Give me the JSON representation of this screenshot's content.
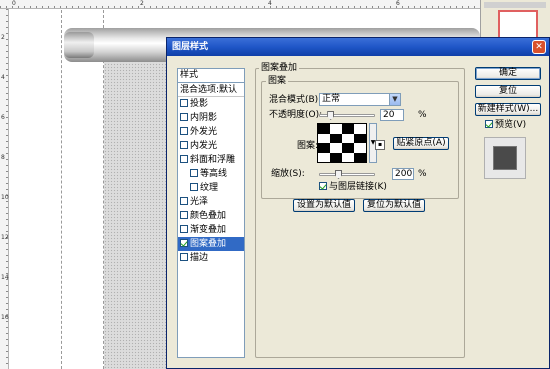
{
  "ruler": {
    "top_numbers": [
      "0",
      "2",
      "4",
      "6"
    ],
    "left_numbers": [
      "2",
      "4",
      "6",
      "8",
      "10",
      "12",
      "14",
      "16"
    ]
  },
  "dialog": {
    "title": "图层样式",
    "close_symbol": "✕",
    "styles_header": "样式",
    "style_items": [
      {
        "label": "混合选项:默认",
        "checkbox": false,
        "checked": false,
        "sub": false,
        "selected": false
      },
      {
        "label": "投影",
        "checkbox": true,
        "checked": false,
        "sub": false,
        "selected": false
      },
      {
        "label": "内阴影",
        "checkbox": true,
        "checked": false,
        "sub": false,
        "selected": false
      },
      {
        "label": "外发光",
        "checkbox": true,
        "checked": false,
        "sub": false,
        "selected": false
      },
      {
        "label": "内发光",
        "checkbox": true,
        "checked": false,
        "sub": false,
        "selected": false
      },
      {
        "label": "斜面和浮雕",
        "checkbox": true,
        "checked": false,
        "sub": false,
        "selected": false
      },
      {
        "label": "等高线",
        "checkbox": true,
        "checked": false,
        "sub": true,
        "selected": false
      },
      {
        "label": "纹理",
        "checkbox": true,
        "checked": false,
        "sub": true,
        "selected": false
      },
      {
        "label": "光泽",
        "checkbox": true,
        "checked": false,
        "sub": false,
        "selected": false
      },
      {
        "label": "颜色叠加",
        "checkbox": true,
        "checked": false,
        "sub": false,
        "selected": false
      },
      {
        "label": "渐变叠加",
        "checkbox": true,
        "checked": false,
        "sub": false,
        "selected": false
      },
      {
        "label": "图案叠加",
        "checkbox": true,
        "checked": true,
        "sub": false,
        "selected": true
      },
      {
        "label": "描边",
        "checkbox": true,
        "checked": false,
        "sub": false,
        "selected": false
      }
    ],
    "section_title": "图案叠加",
    "subsection_title": "图案",
    "blend_mode_label": "混合模式(B):",
    "blend_mode_value": "正常",
    "opacity_label": "不透明度(O):",
    "opacity_value": "20",
    "opacity_unit": "%",
    "opacity_fraction": 0.2,
    "pattern_label": "图案:",
    "snap_origin_label": "贴紧原点(A)",
    "scale_label": "缩放(S):",
    "scale_value": "200",
    "scale_unit": "%",
    "link_layer_label": "与图层链接(K)",
    "link_layer_checked": true,
    "set_default_label": "设置为默认值",
    "reset_default_label": "复位为默认值",
    "ok_label": "确定",
    "reset_label": "复位",
    "new_style_label": "新建样式(W)...",
    "preview_label": "预览(V)",
    "preview_checked": true
  },
  "colors": {
    "titlebar": "#1f56c7",
    "selection": "#316ac5",
    "dialog_bg": "#ece9d8"
  }
}
